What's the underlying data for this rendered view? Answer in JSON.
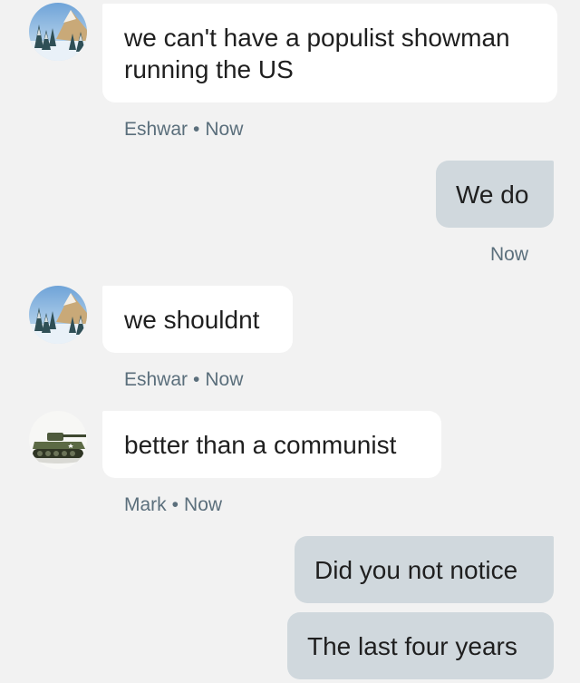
{
  "messages": [
    {
      "sender": "Eshwar",
      "text_line1": "we can't have a populist showman",
      "text_line2": "running the US",
      "time": "Now",
      "dot": "•",
      "avatar": "snowy-forest-avatar"
    },
    {
      "sender": "",
      "text": "We do",
      "time": "Now"
    },
    {
      "sender": "Eshwar",
      "text": "we shouldnt",
      "time": "Now",
      "dot": "•",
      "avatar": "snowy-forest-avatar"
    },
    {
      "sender": "Mark",
      "text": "better than a communist",
      "time": "Now",
      "dot": "•",
      "avatar": "tank-avatar"
    },
    {
      "sender": "",
      "text": "Did you not notice"
    },
    {
      "sender": "",
      "text": "The last four years"
    }
  ],
  "colors": {
    "background": "#f2f2f2",
    "incoming_bubble": "#ffffff",
    "outgoing_bubble": "#d0d8dd",
    "meta_text": "#5b6f7c"
  }
}
